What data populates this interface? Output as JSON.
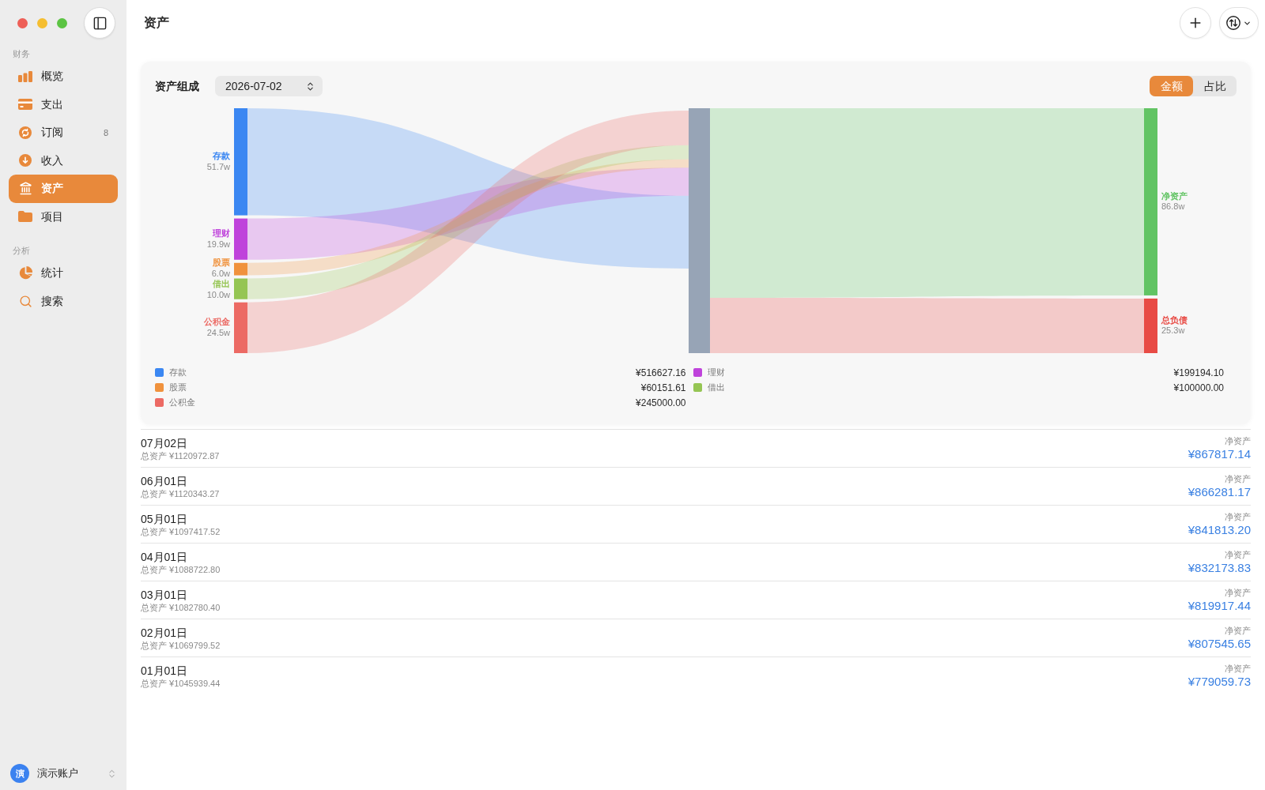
{
  "sidebar": {
    "sections": [
      {
        "title": "财务",
        "items": [
          {
            "label": "概览",
            "selected": false
          },
          {
            "label": "支出",
            "selected": false
          },
          {
            "label": "订阅",
            "selected": false,
            "badge": "8"
          },
          {
            "label": "收入",
            "selected": false
          },
          {
            "label": "资产",
            "selected": true
          },
          {
            "label": "项目",
            "selected": false
          }
        ]
      },
      {
        "title": "分析",
        "items": [
          {
            "label": "统计",
            "selected": false
          },
          {
            "label": "搜索",
            "selected": false
          }
        ]
      }
    ],
    "account": {
      "avatar": "演",
      "name": "演示账户"
    }
  },
  "header": {
    "title": "资产"
  },
  "composition": {
    "title": "资产组成",
    "date": "2026-07-02",
    "modes": [
      {
        "label": "金额",
        "selected": true
      },
      {
        "label": "占比",
        "selected": false
      }
    ],
    "sankey": {
      "sources": [
        {
          "label": "存款",
          "value": "51.7w",
          "color": "#3b87f2"
        },
        {
          "label": "理财",
          "value": "19.9w",
          "color": "#bf43db"
        },
        {
          "label": "股票",
          "value": "6.0w",
          "color": "#f0923d"
        },
        {
          "label": "借出",
          "value": "10.0w",
          "color": "#95c553"
        },
        {
          "label": "公积金",
          "value": "24.5w",
          "color": "#ec6a64"
        }
      ],
      "targets": [
        {
          "label": "净资产",
          "value": "86.8w",
          "color": "#62c464"
        },
        {
          "label": "总负债",
          "value": "25.3w",
          "color": "#e84b45"
        }
      ]
    },
    "legend": [
      {
        "label": "存款",
        "amount": "¥516627.16",
        "color": "#3b87f2"
      },
      {
        "label": "理财",
        "amount": "¥199194.10",
        "color": "#bf43db"
      },
      {
        "label": "股票",
        "amount": "¥60151.61",
        "color": "#f0923d"
      },
      {
        "label": "借出",
        "amount": "¥100000.00",
        "color": "#95c553"
      },
      {
        "label": "公积金",
        "amount": "¥245000.00",
        "color": "#ec6a64"
      }
    ]
  },
  "snapshots": [
    {
      "date": "07月02日",
      "total": "总资产 ¥1120972.87",
      "net_label": "净资产",
      "net": "¥867817.14"
    },
    {
      "date": "06月01日",
      "total": "总资产 ¥1120343.27",
      "net_label": "净资产",
      "net": "¥866281.17"
    },
    {
      "date": "05月01日",
      "total": "总资产 ¥1097417.52",
      "net_label": "净资产",
      "net": "¥841813.20"
    },
    {
      "date": "04月01日",
      "total": "总资产 ¥1088722.80",
      "net_label": "净资产",
      "net": "¥832173.83"
    },
    {
      "date": "03月01日",
      "total": "总资产 ¥1082780.40",
      "net_label": "净资产",
      "net": "¥819917.44"
    },
    {
      "date": "02月01日",
      "total": "总资产 ¥1069799.52",
      "net_label": "净资产",
      "net": "¥807545.65"
    },
    {
      "date": "01月01日",
      "total": "总资产 ¥1045939.44",
      "net_label": "净资产",
      "net": "¥779059.73"
    }
  ]
}
